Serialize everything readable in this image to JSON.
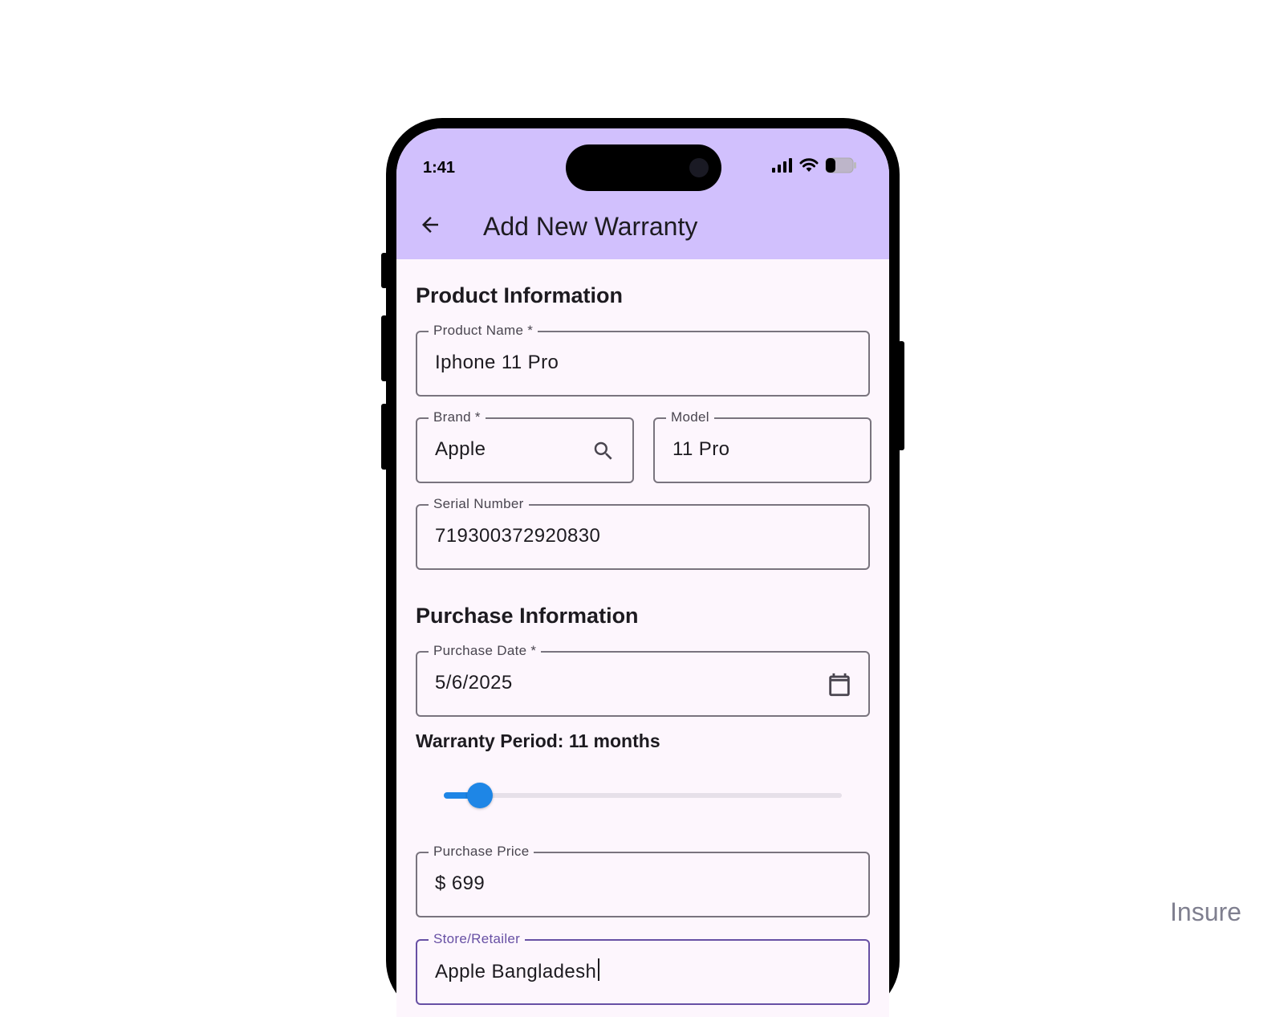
{
  "status_bar": {
    "time": "1:41"
  },
  "app_bar": {
    "title": "Add New Warranty"
  },
  "product_section": {
    "title": "Product Information",
    "product_name": {
      "label": "Product Name *",
      "value": "Iphone 11 Pro"
    },
    "brand": {
      "label": "Brand *",
      "value": "Apple"
    },
    "model": {
      "label": "Model",
      "value": "11 Pro"
    },
    "serial": {
      "label": "Serial Number",
      "value": "719300372920830"
    }
  },
  "purchase_section": {
    "title": "Purchase Information",
    "purchase_date": {
      "label": "Purchase Date *",
      "value": "5/6/2025"
    },
    "warranty_period_label": "Warranty Period: 11 months",
    "warranty_slider_fraction": 0.09,
    "purchase_price": {
      "label": "Purchase Price",
      "prefix": "$",
      "value": "699"
    },
    "store": {
      "label": "Store/Retailer",
      "value": "Apple Bangladesh"
    }
  },
  "colors": {
    "app_bar": "#d1c0fd",
    "background": "#fdf6fd",
    "slider_accent": "#1e86e6",
    "focus": "#6750a4"
  },
  "icons": {
    "back": "arrow-left-icon",
    "brand_search": "search-icon",
    "date_picker": "calendar-icon"
  },
  "watermark": "Insure"
}
